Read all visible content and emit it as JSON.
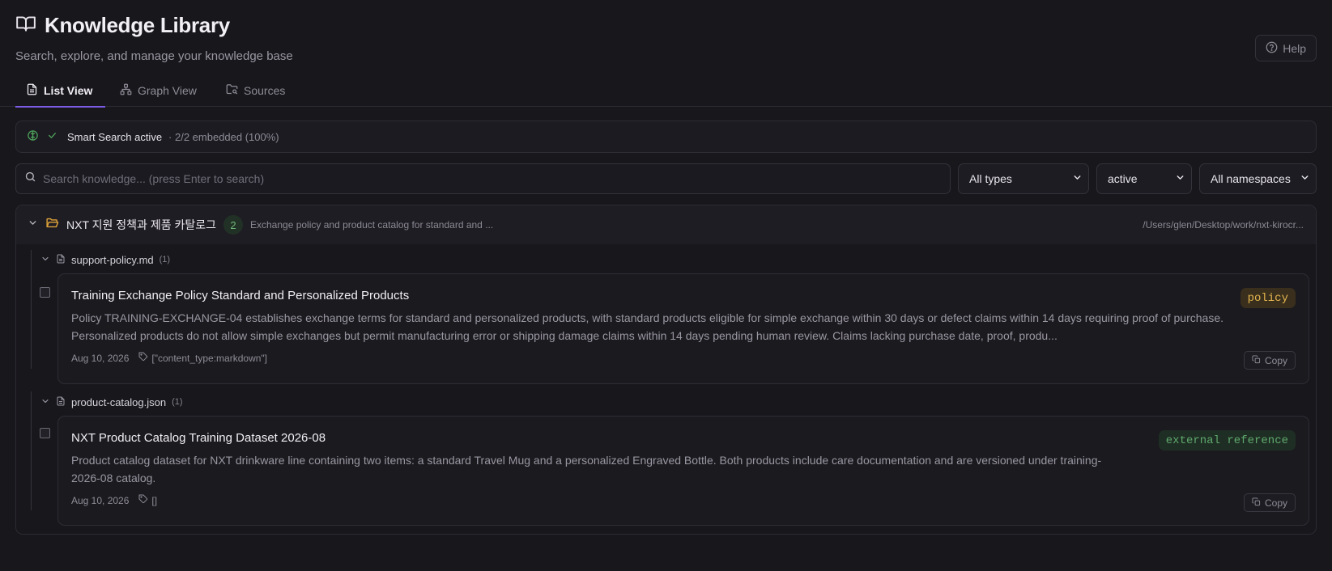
{
  "header": {
    "title": "Knowledge Library",
    "subtitle": "Search, explore, and manage your knowledge base",
    "help_label": "Help"
  },
  "tabs": [
    {
      "label": "List View",
      "active": true
    },
    {
      "label": "Graph View",
      "active": false
    },
    {
      "label": "Sources",
      "active": false
    }
  ],
  "smart_search": {
    "status": "Smart Search active",
    "embedded": "· 2/2 embedded (100%)"
  },
  "search": {
    "placeholder": "Search knowledge... (press Enter to search)",
    "value": ""
  },
  "filters": {
    "type": "All types",
    "status": "active",
    "namespace": "All namespaces"
  },
  "group": {
    "name": "NXT 지원 정책과 제품 카탈로그",
    "count": "2",
    "description": "Exchange policy and product catalog for standard and ...",
    "path": "/Users/glen/Desktop/work/nxt-kirocr..."
  },
  "files": [
    {
      "name": "support-policy.md",
      "count": "(1)",
      "entry": {
        "title": "Training Exchange Policy Standard and Personalized Products",
        "description": "Policy TRAINING-EXCHANGE-04 establishes exchange terms for standard and personalized products, with standard products eligible for simple exchange within 30 days or defect claims within 14 days requiring proof of purchase. Personalized products do not allow simple exchanges but permit manufacturing error or shipping damage claims within 14 days pending human review. Claims lacking purchase date, proof, produ...",
        "date": "Aug 10, 2026",
        "tags": "[\"content_type:markdown\"]",
        "type_badge": "policy",
        "copy_label": "Copy"
      }
    },
    {
      "name": "product-catalog.json",
      "count": "(1)",
      "entry": {
        "title": "NXT Product Catalog Training Dataset 2026-08",
        "description": "Product catalog dataset for NXT drinkware line containing two items: a standard Travel Mug and a personalized Engraved Bottle. Both products include care documentation and are versioned under training-2026-08 catalog.",
        "date": "Aug 10, 2026",
        "tags": "[]",
        "type_badge": "external reference",
        "copy_label": "Copy"
      }
    }
  ],
  "colors": {
    "accent": "#7c5ce6",
    "policy_badge_bg": "#3a2f1c",
    "policy_badge_text": "#e3b54f",
    "external_badge_bg": "#1f2e24",
    "external_badge_text": "#5fa86d",
    "smart_icon": "#4fa35c"
  }
}
